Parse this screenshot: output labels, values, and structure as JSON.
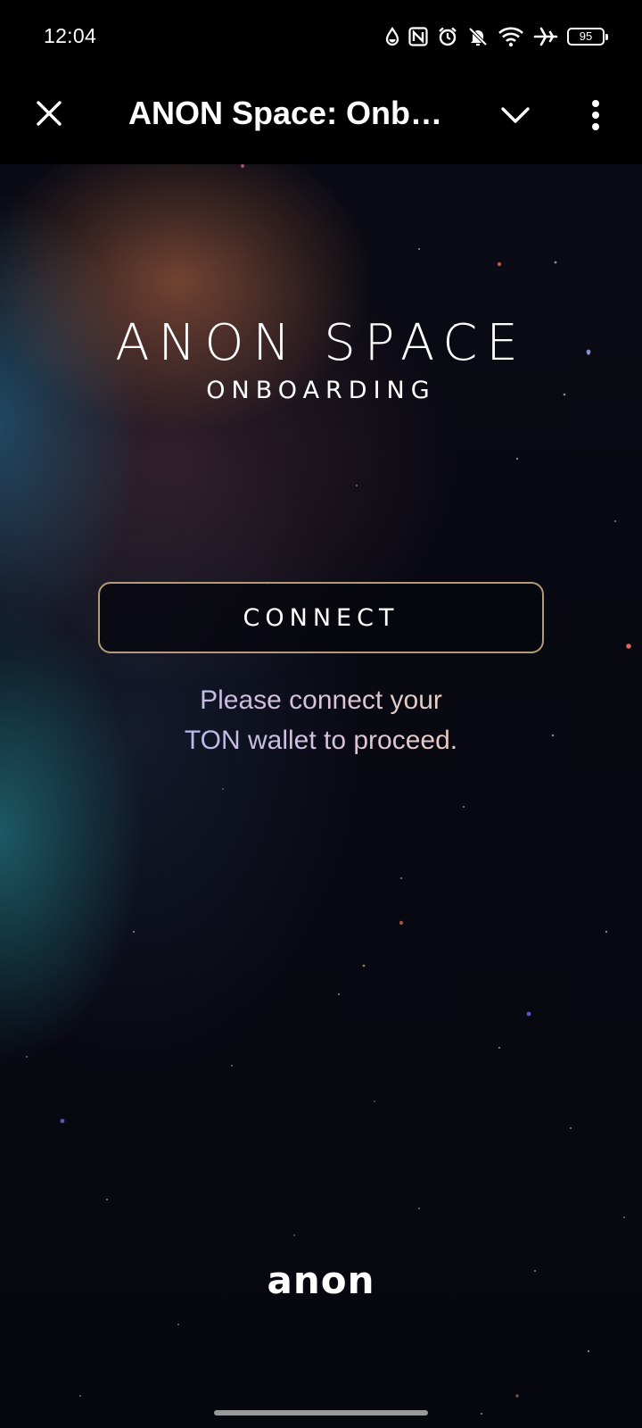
{
  "status_bar": {
    "time": "12:04",
    "battery_level": "95",
    "icons": [
      "drop-icon",
      "nfc-icon",
      "alarm-icon",
      "bell-off-icon",
      "wifi-icon",
      "airplane-icon",
      "battery-icon"
    ]
  },
  "app_bar": {
    "title": "ANON Space: Onb…",
    "icons": [
      "close-icon",
      "chevron-down-icon",
      "more-vert-icon"
    ]
  },
  "page": {
    "title": "ANON SPACE",
    "subtitle": "ONBOARDING",
    "connect_label": "CONNECT",
    "hint_line1": "Please connect your",
    "hint_line2": "TON wallet to proceed.",
    "footer_logo": "anon"
  },
  "colors": {
    "background": "#07070f",
    "button_border": "#b39a7a",
    "hint_gradient_start": "#b9b4f3",
    "hint_gradient_end": "#f1d9b6"
  }
}
